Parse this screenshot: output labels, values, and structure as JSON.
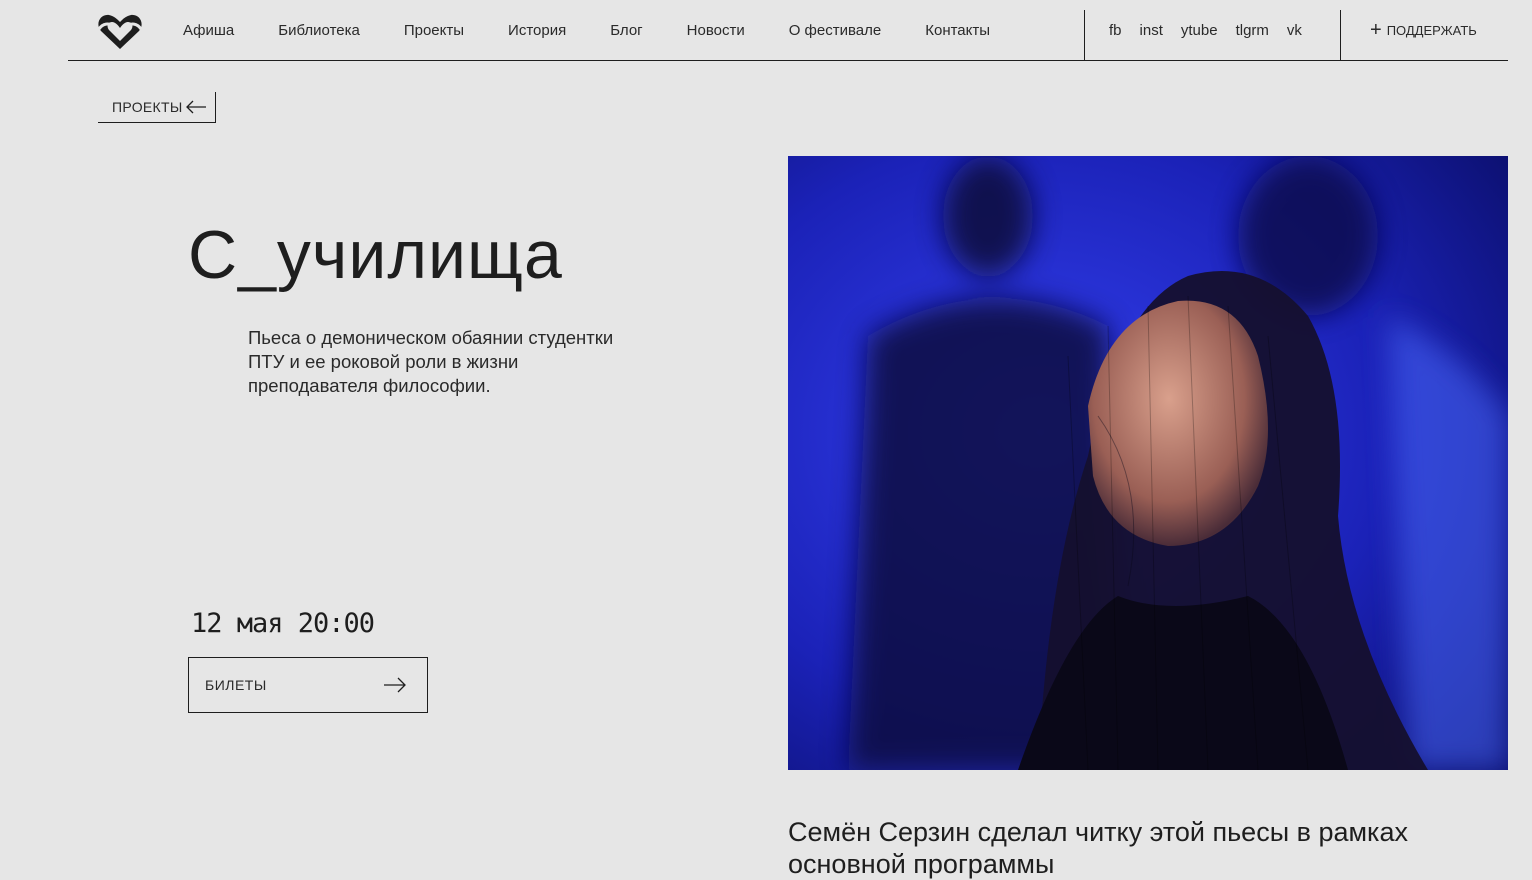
{
  "header": {
    "logo_icon": "heart-logo-icon",
    "nav": [
      {
        "label": "Афиша"
      },
      {
        "label": "Библиотека"
      },
      {
        "label": "Проекты"
      },
      {
        "label": "История"
      },
      {
        "label": "Блог"
      },
      {
        "label": "Новости"
      },
      {
        "label": "О фестивале"
      },
      {
        "label": "Контакты"
      }
    ],
    "social": [
      {
        "label": "fb"
      },
      {
        "label": "inst"
      },
      {
        "label": "ytube"
      },
      {
        "label": "tlgrm"
      },
      {
        "label": "vk"
      }
    ],
    "support_label": "ПОДДЕРЖАТЬ",
    "support_icon": "plus-icon"
  },
  "back_link": {
    "label": "ПРОЕКТЫ",
    "icon": "arrow-left-icon"
  },
  "event": {
    "title": "С_училища",
    "description": "Пьеса о демоническом обаянии студентки ПТУ и ее роковой роли в жизни преподавателя философии.",
    "datetime": "12 мая 20:00",
    "tickets_label": "БИЛЕТЫ",
    "tickets_icon": "arrow-right-icon"
  },
  "photo": {
    "icon": "event-photo"
  },
  "caption": "Семён Серзин сделал читку этой пьесы в рамках основной программы",
  "colors": {
    "background": "#e6e6e6",
    "text": "#1e1e1e",
    "photo_blue": "#1a1fb0"
  }
}
